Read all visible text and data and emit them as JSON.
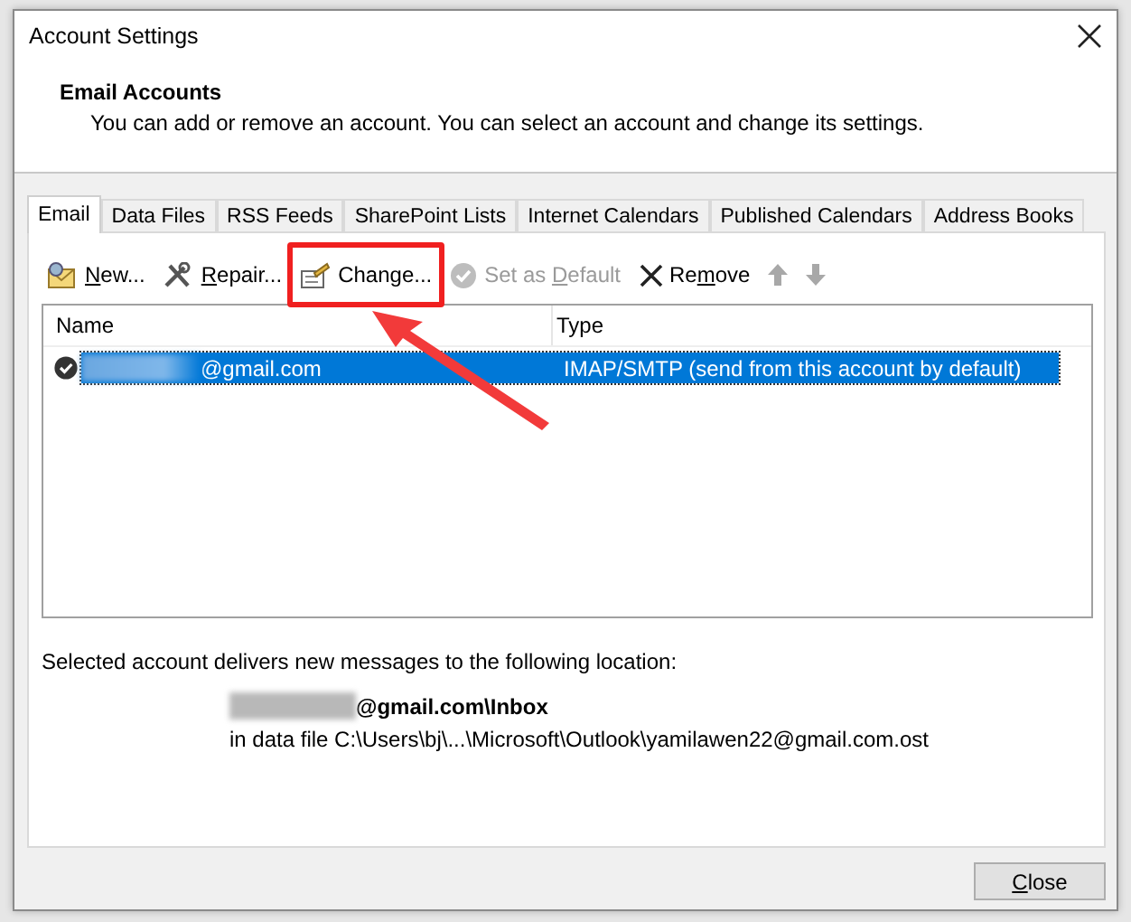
{
  "window": {
    "title": "Account Settings"
  },
  "header": {
    "heading": "Email Accounts",
    "description": "You can add or remove an account. You can select an account and change its settings."
  },
  "tabs": [
    {
      "label": "Email",
      "selected": true
    },
    {
      "label": "Data Files",
      "selected": false
    },
    {
      "label": "RSS Feeds",
      "selected": false
    },
    {
      "label": "SharePoint Lists",
      "selected": false
    },
    {
      "label": "Internet Calendars",
      "selected": false
    },
    {
      "label": "Published Calendars",
      "selected": false
    },
    {
      "label": "Address Books",
      "selected": false
    }
  ],
  "toolbar": [
    {
      "kind": "new",
      "label": "New...",
      "disabled": false,
      "highlighted": false
    },
    {
      "kind": "repair",
      "label": "Repair...",
      "disabled": false,
      "highlighted": false
    },
    {
      "kind": "change",
      "label": "Change...",
      "disabled": false,
      "highlighted": true
    },
    {
      "kind": "default",
      "label": "Set as Default",
      "disabled": true,
      "highlighted": false
    },
    {
      "kind": "remove",
      "label": "Remove",
      "disabled": false,
      "highlighted": false
    },
    {
      "kind": "up",
      "disabled": true,
      "highlighted": false
    },
    {
      "kind": "down",
      "disabled": true,
      "highlighted": false
    }
  ],
  "accounts": {
    "columns": [
      "Name",
      "Type"
    ],
    "rows": [
      {
        "name": "@gmail.com",
        "redacted": true,
        "type": "IMAP/SMTP (send from this account by default)",
        "default": true,
        "selected": true
      }
    ]
  },
  "delivery": {
    "caption": "Selected account delivers new messages to the following location:",
    "folder": "@gmail.com\\Inbox",
    "folder_redacted": true,
    "data_file": "in data file C:\\Users\\bj\\...\\Microsoft\\Outlook\\yamilawen22@gmail.com.ost"
  },
  "close_button": {
    "label": "Close"
  },
  "annotation": {
    "kind": "arrow"
  }
}
